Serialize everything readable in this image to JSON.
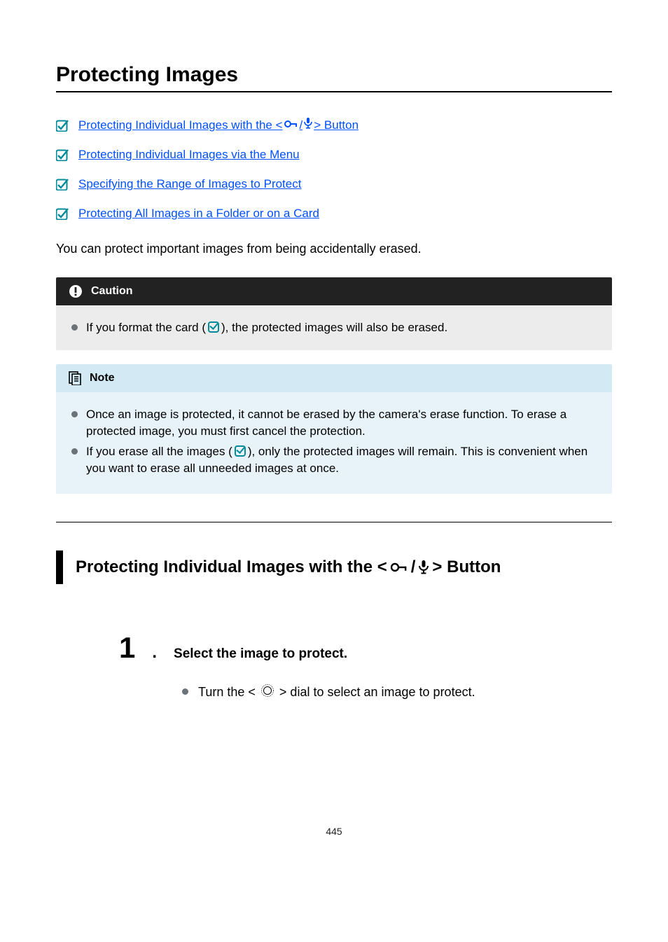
{
  "title": "Protecting Images",
  "toc": [
    {
      "pref": "Protecting Individual Images with the <",
      "mid1": "/",
      "suf": "> Button"
    },
    {
      "text": "Protecting Individual Images via the Menu"
    },
    {
      "text": "Specifying the Range of Images to Protect"
    },
    {
      "text": "Protecting All Images in a Folder or on a Card"
    }
  ],
  "intro": "You can protect important images from being accidentally erased.",
  "caution": {
    "heading": "Caution",
    "items": [
      {
        "pre": "If you format the card (",
        "post": "), the protected images will also be erased."
      }
    ]
  },
  "note": {
    "heading": "Note",
    "items": [
      {
        "text": "Once an image is protected, it cannot be erased by the camera's erase function. To erase a protected image, you must first cancel the protection."
      },
      {
        "pre": "If you erase all the images (",
        "post": "), only the protected images will remain. This is convenient when you want to erase all unneeded images at once."
      }
    ]
  },
  "section2": {
    "pre": "Protecting Individual Images with the <",
    "mid": "/",
    "suf": "> Button"
  },
  "step": {
    "num": "1",
    "dot": ".",
    "title": "Select the image to protect.",
    "sub_pre": "Turn the <",
    "sub_post": "> dial to select an image to protect."
  },
  "page_number": "445"
}
